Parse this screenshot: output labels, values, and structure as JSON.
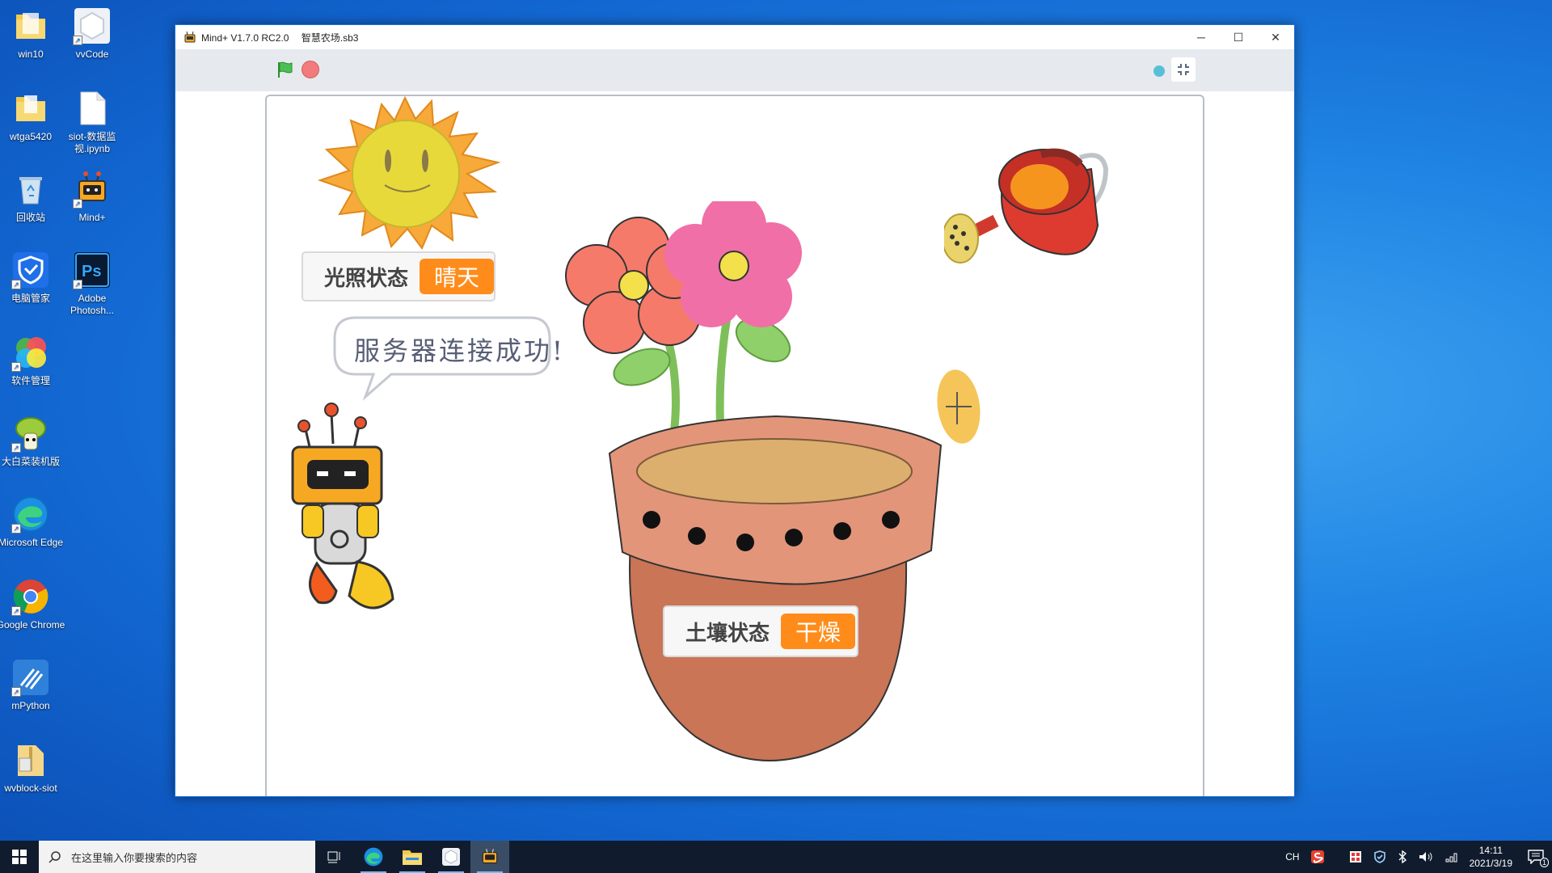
{
  "desktop": {
    "icons": [
      {
        "label": "win10",
        "icon": "folder-icon"
      },
      {
        "label": "vvCode",
        "icon": "vvcode-icon"
      },
      {
        "label": "wtga5420",
        "icon": "folder-icon"
      },
      {
        "label": "siot-数据监视.ipynb",
        "icon": "file-icon"
      },
      {
        "label": "回收站",
        "icon": "recycle-bin-icon"
      },
      {
        "label": "Mind+",
        "icon": "mindplus-icon"
      },
      {
        "label": "电脑管家",
        "icon": "pc-manager-icon"
      },
      {
        "label": "Adobe Photosh...",
        "icon": "photoshop-icon"
      },
      {
        "label": "软件管理",
        "icon": "software-manager-icon"
      },
      {
        "label": "大白菜装机版",
        "icon": "dabaicai-icon"
      },
      {
        "label": "Microsoft Edge",
        "icon": "edge-icon"
      },
      {
        "label": "Google Chrome",
        "icon": "chrome-icon"
      },
      {
        "label": "mPython",
        "icon": "mpython-icon"
      },
      {
        "label": "wvblock-siot",
        "icon": "folder-zip-icon"
      }
    ]
  },
  "window": {
    "app_name": "Mind+ V1.7.0 RC2.0",
    "file_name": "智慧农场.sb3",
    "minimize": "─",
    "maximize": "☐",
    "close": "✕"
  },
  "stage": {
    "light_monitor": {
      "label": "光照状态",
      "value": "晴天"
    },
    "soil_monitor": {
      "label": "土壤状态",
      "value": "干燥"
    },
    "speech_bubble": "服务器连接成功!"
  },
  "taskbar": {
    "search_placeholder": "在这里输入你要搜索的内容",
    "ime": "CH",
    "time": "14:11",
    "date": "2021/3/19",
    "notification_count": "1"
  },
  "colors": {
    "monitor_value_bg": "#ff8c1a",
    "desktop_blue": "#1f84e3",
    "taskbar_bg": "#101c2e"
  }
}
